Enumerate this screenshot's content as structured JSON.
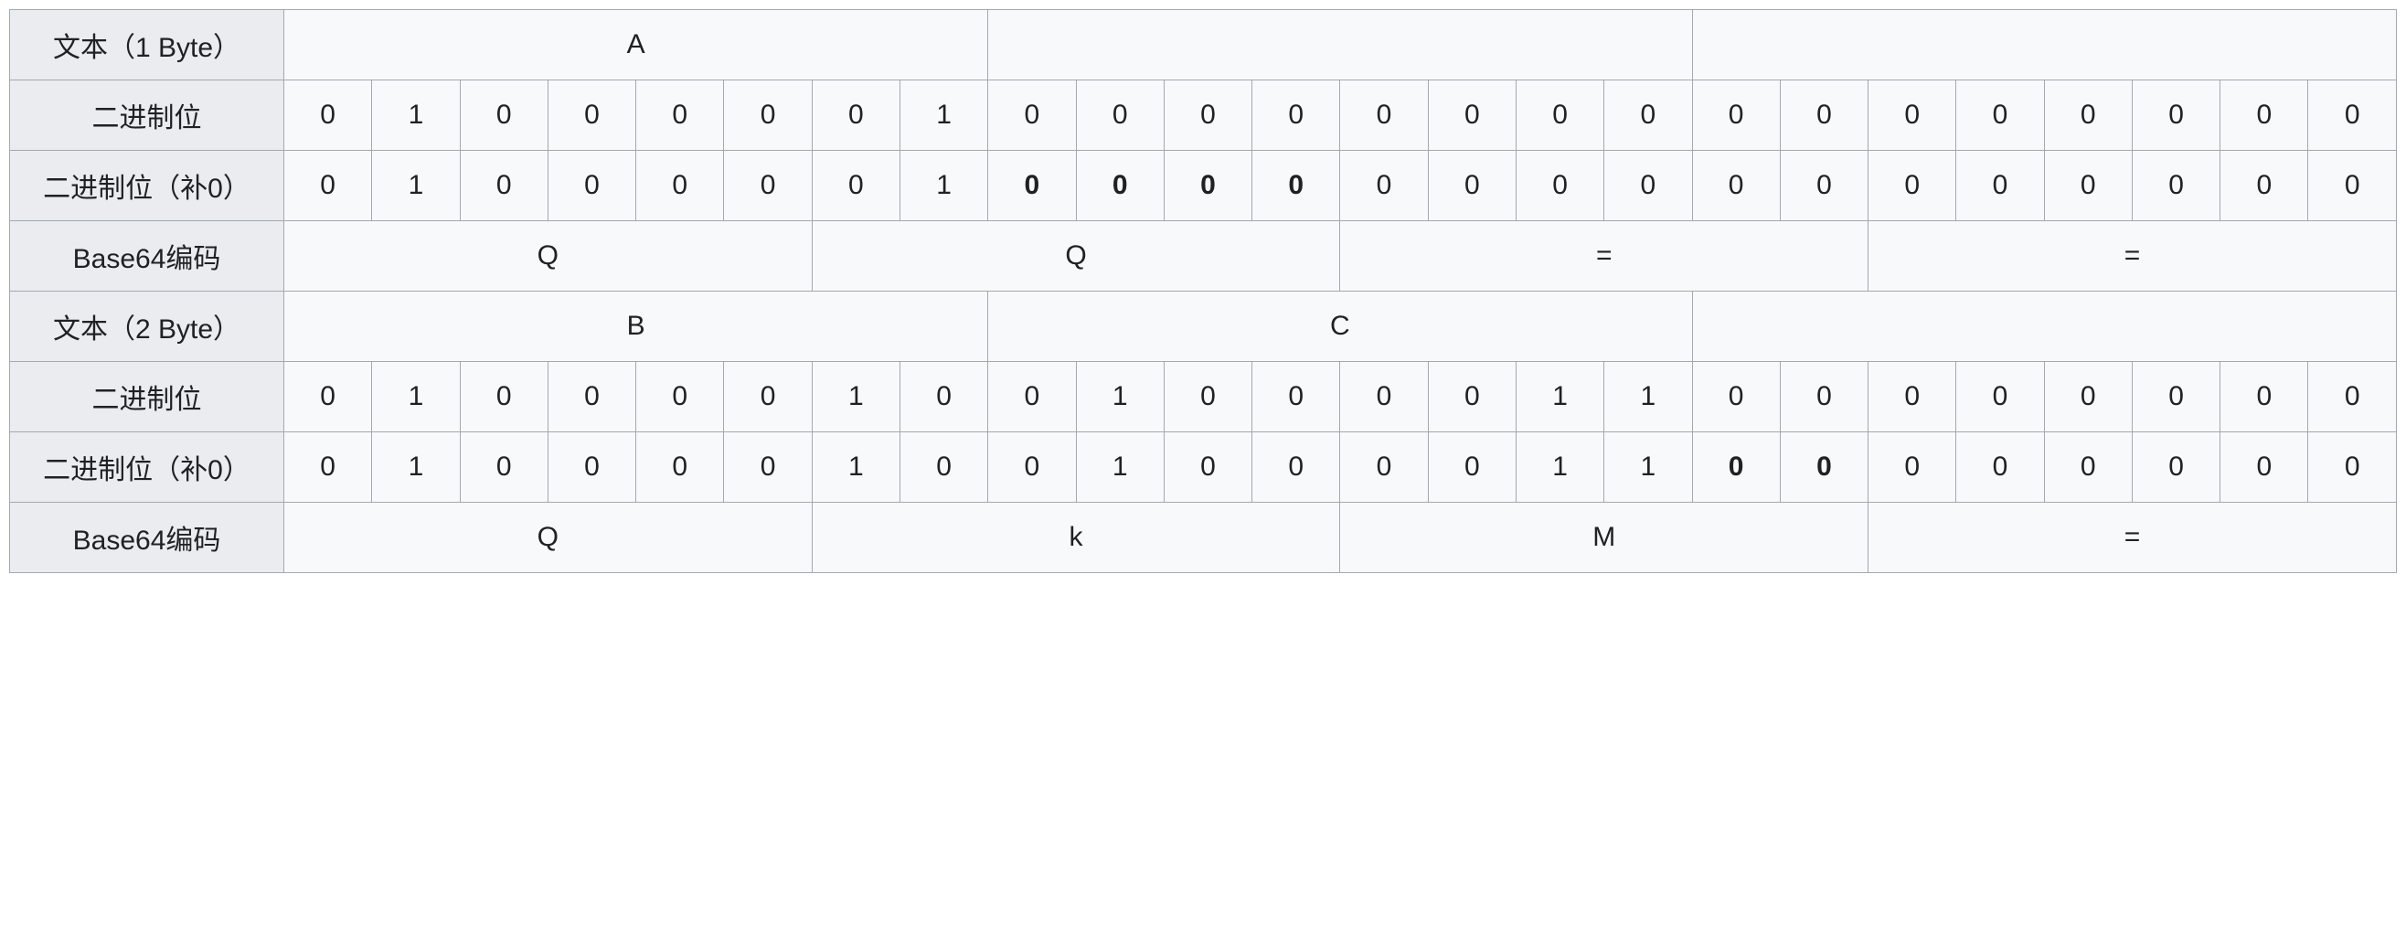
{
  "rows": {
    "text_1byte": {
      "label": "文本（1 Byte）",
      "cells": [
        "A",
        "",
        ""
      ]
    },
    "bits_1": {
      "label": "二进制位",
      "cells": [
        "0",
        "1",
        "0",
        "0",
        "0",
        "0",
        "0",
        "1",
        "0",
        "0",
        "0",
        "0",
        "0",
        "0",
        "0",
        "0",
        "0",
        "0",
        "0",
        "0",
        "0",
        "0",
        "0",
        "0"
      ]
    },
    "bits_1_pad": {
      "label": "二进制位（补0）",
      "cells": [
        "0",
        "1",
        "0",
        "0",
        "0",
        "0",
        "0",
        "1",
        "0",
        "0",
        "0",
        "0",
        "0",
        "0",
        "0",
        "0",
        "0",
        "0",
        "0",
        "0",
        "0",
        "0",
        "0",
        "0"
      ],
      "bold_indices": [
        8,
        9,
        10,
        11
      ]
    },
    "b64_1": {
      "label": "Base64编码",
      "cells": [
        "Q",
        "Q",
        "=",
        "="
      ]
    },
    "text_2byte": {
      "label": "文本（2 Byte）",
      "cells": [
        "B",
        "C",
        ""
      ]
    },
    "bits_2": {
      "label": "二进制位",
      "cells": [
        "0",
        "1",
        "0",
        "0",
        "0",
        "0",
        "1",
        "0",
        "0",
        "1",
        "0",
        "0",
        "0",
        "0",
        "1",
        "1",
        "0",
        "0",
        "0",
        "0",
        "0",
        "0",
        "0",
        "0"
      ]
    },
    "bits_2_pad": {
      "label": "二进制位（补0）",
      "cells": [
        "0",
        "1",
        "0",
        "0",
        "0",
        "0",
        "1",
        "0",
        "0",
        "1",
        "0",
        "0",
        "0",
        "0",
        "1",
        "1",
        "0",
        "0",
        "0",
        "0",
        "0",
        "0",
        "0",
        "0"
      ],
      "bold_indices": [
        16,
        17
      ]
    },
    "b64_2": {
      "label": "Base64编码",
      "cells": [
        "Q",
        "k",
        "M",
        "="
      ]
    }
  }
}
